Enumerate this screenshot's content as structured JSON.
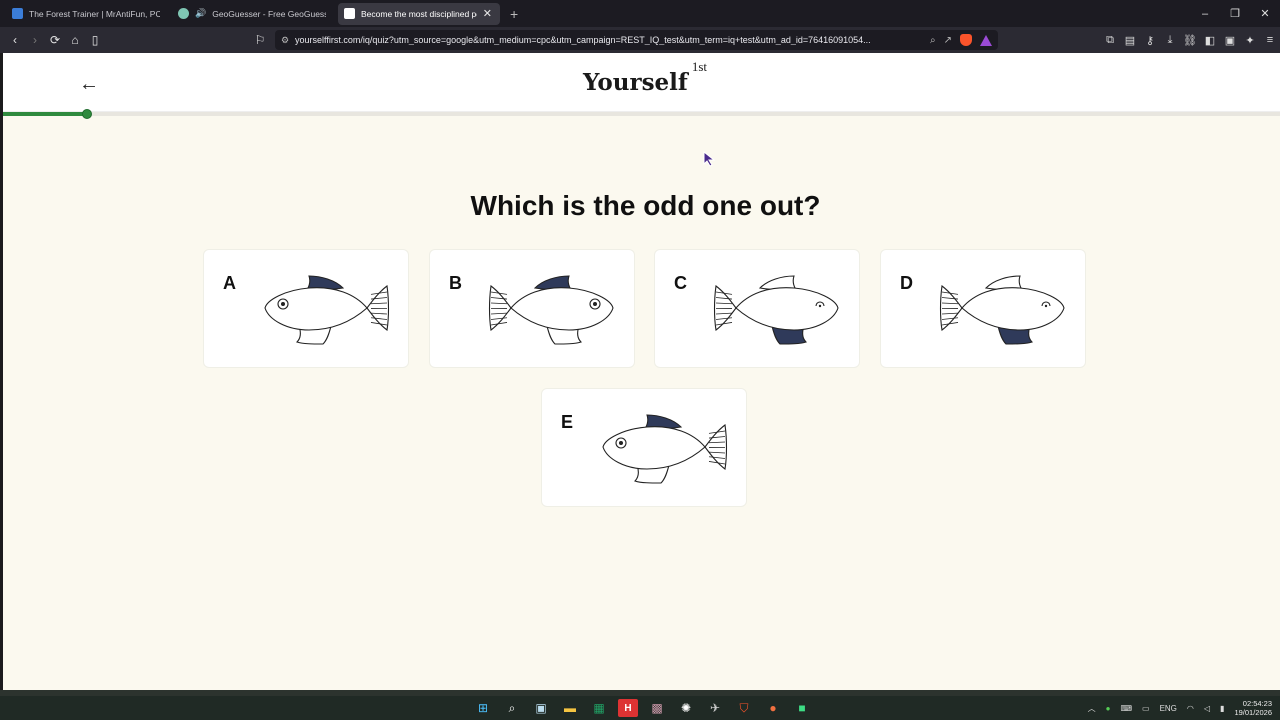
{
  "tabs": [
    {
      "title": "The Forest Trainer | MrAntiFun, PC Video Game Trainers",
      "icon": "forest-favicon-icon",
      "active": false
    },
    {
      "title": "GeoGuesser - Free GeoGuessr Alternative",
      "icon": "geoguesser-favicon-icon",
      "active": false
    },
    {
      "title": "Become the most disciplined person",
      "icon": "yourself-favicon-icon",
      "active": true
    }
  ],
  "window_controls": {
    "minimize": "–",
    "maximize": "❐",
    "close": "✕"
  },
  "toolbar": {
    "url": "yourselffirst.com/iq/quiz?utm_source=google&utm_medium=cpc&utm_campaign=REST_IQ_test&utm_term=iq+test&utm_ad_id=76416091054..."
  },
  "site": {
    "brand": "Yourself",
    "brand_sup": "1st",
    "back_icon": "arrow-left-icon",
    "progress_fraction": 0.066
  },
  "quiz": {
    "question": "Which is the odd one out?",
    "options": [
      {
        "label": "A",
        "facing": "left",
        "tail_striped": true,
        "top_fin_dark": true,
        "bottom_fin_dark": false,
        "eye_round": true
      },
      {
        "label": "B",
        "facing": "right",
        "tail_striped": true,
        "top_fin_dark": true,
        "bottom_fin_dark": false,
        "eye_round": true
      },
      {
        "label": "C",
        "facing": "right",
        "tail_striped": true,
        "top_fin_dark": false,
        "bottom_fin_dark": true,
        "eye_round": false
      },
      {
        "label": "D",
        "facing": "right",
        "tail_striped": true,
        "top_fin_dark": false,
        "bottom_fin_dark": true,
        "eye_round": false
      },
      {
        "label": "E",
        "facing": "left",
        "tail_striped": true,
        "top_fin_dark": true,
        "bottom_fin_dark": false,
        "eye_round": true
      }
    ]
  },
  "taskbar": {
    "language": "ENG",
    "time": "02:54:23",
    "date": "19/01/2026"
  },
  "colors": {
    "page_bg": "#fbf9ef",
    "progress": "#2f8a3e",
    "fin_dark": "#2f3a5a"
  }
}
